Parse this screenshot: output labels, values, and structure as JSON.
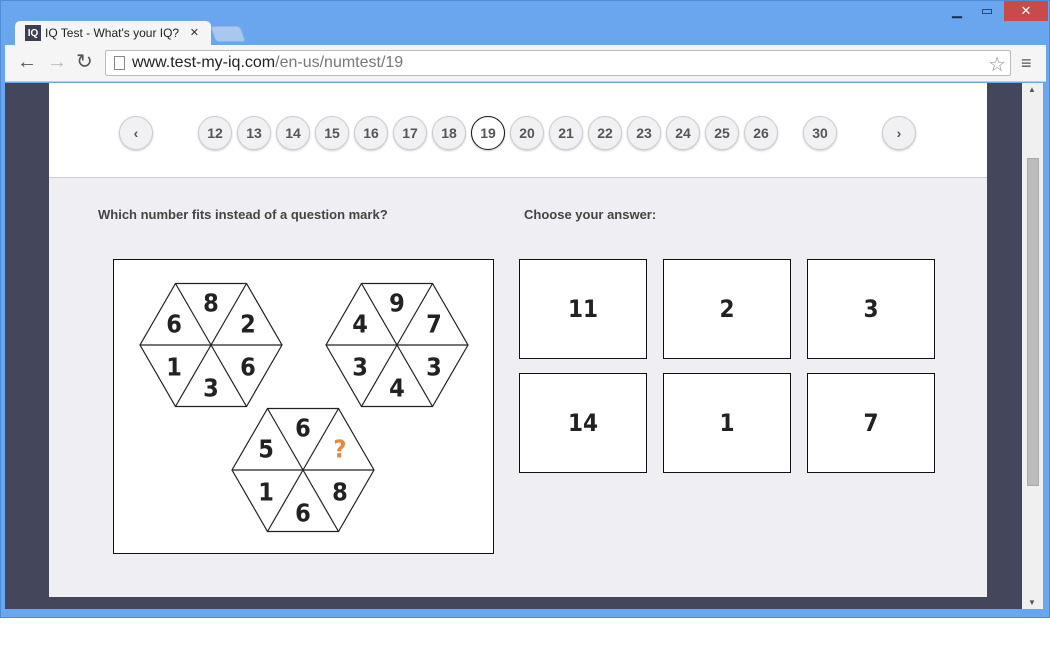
{
  "browser": {
    "tab_title": "IQ Test - What's your IQ?",
    "favicon": "IQ",
    "url_host": "www.test-my-iq.com",
    "url_path": "/en-us/numtest/19"
  },
  "pager": {
    "pages": [
      "12",
      "13",
      "14",
      "15",
      "16",
      "17",
      "18",
      "19",
      "20",
      "21",
      "22",
      "23",
      "24",
      "25",
      "26"
    ],
    "last": "30",
    "current": "19"
  },
  "question": {
    "prompt": "Which number fits instead of a question mark?",
    "answer_prompt": "Choose your answer:"
  },
  "puzzle": {
    "hexagons": [
      [
        "8",
        "2",
        "6",
        "3",
        "1",
        "6"
      ],
      [
        "9",
        "7",
        "3",
        "4",
        "3",
        "4"
      ],
      [
        "6",
        "?",
        "8",
        "6",
        "1",
        "5"
      ]
    ],
    "question_color": "#e8873a"
  },
  "answers": [
    "11",
    "2",
    "3",
    "14",
    "1",
    "7"
  ]
}
